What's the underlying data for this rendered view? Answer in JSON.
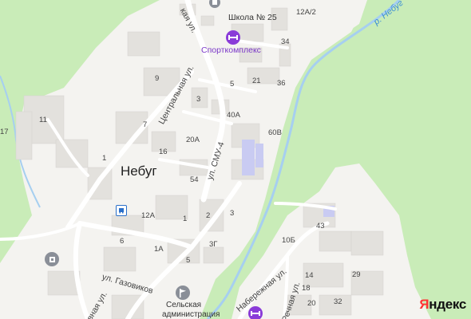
{
  "map": {
    "city": "Небуг",
    "river": "р. Небуг",
    "streets": {
      "central": "Центральная ул.",
      "smu4": "ул. СМУ-4",
      "gazovikov": "ул. Газовиков",
      "naberezhnaya": "Набережная ул.",
      "rechnaya": "Речная ул.",
      "top_partial": "кая ул.",
      "bottom_partial": "вная ул."
    },
    "pois": {
      "school": "Школа № 25",
      "sport": "Спорткомплекс",
      "admin_line1": "Сельская",
      "admin_line2": "администрация"
    },
    "houses": {
      "h12a2": "12А/2",
      "h34": "34",
      "h5": "5",
      "h21": "21",
      "h36": "36",
      "h9": "9",
      "h3a": "3",
      "h40a": "40А",
      "h11": "11",
      "h7": "7",
      "h60b": "60В",
      "h17": "17",
      "h20a": "20А",
      "h16": "16",
      "h1a": "1",
      "h54": "54",
      "h43": "43",
      "h12a": "12А",
      "h1b": "1",
      "h2": "2",
      "h3b": "3",
      "h6": "6",
      "h10b": "10Б",
      "h1a2": "1А",
      "h3g": "3Г",
      "h29": "29",
      "h5b": "5",
      "h14": "14",
      "h18": "18",
      "h20": "20",
      "h32": "32"
    },
    "colors": {
      "park": "#c9ecb8",
      "urban": "#f4f3f0",
      "building": "#e3e1dd",
      "road": "#ffffff",
      "river": "#a6cff0",
      "poi_purple": "#8a3bd8"
    }
  },
  "logo": {
    "y": "Я",
    "rest": "ндекс"
  }
}
